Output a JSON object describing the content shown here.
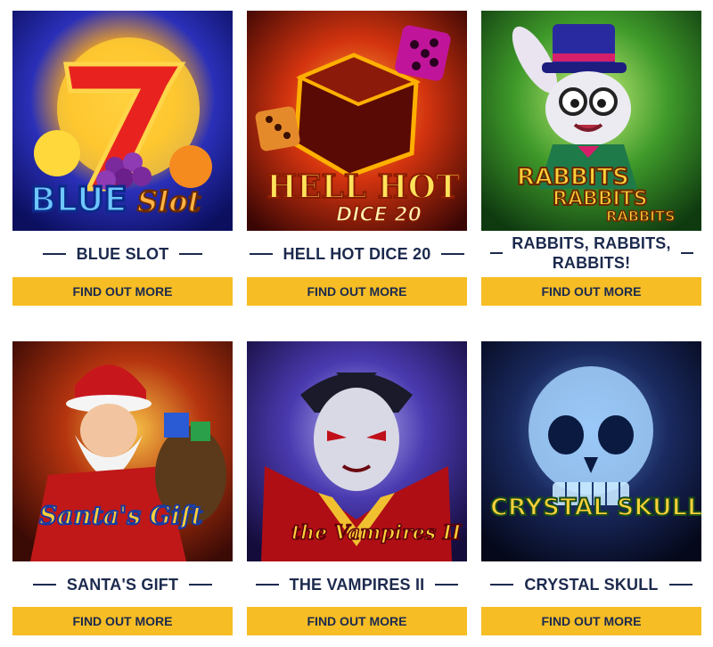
{
  "games": [
    {
      "title": "BLUE SLOT",
      "art_text": "BLUE",
      "art_text2": "Slot",
      "button": "FIND OUT MORE"
    },
    {
      "title": "HELL HOT DICE 20",
      "art_text": "HELL HOT",
      "art_text2": "DICE 20",
      "button": "FIND OUT MORE"
    },
    {
      "title": "RABBITS, RABBITS, RABBITS!",
      "art_text": "RABBITS",
      "art_text2": "RABBITS",
      "art_text3": "RABBITS",
      "button": "FIND OUT MORE"
    },
    {
      "title": "SANTA'S GIFT",
      "art_text": "Santa's Gift",
      "button": "FIND OUT MORE"
    },
    {
      "title": "THE VAMPIRES II",
      "art_text": "the Vampires II",
      "button": "FIND OUT MORE"
    },
    {
      "title": "CRYSTAL SKULL",
      "art_text": "CRYSTAL SKULL",
      "button": "FIND OUT MORE"
    }
  ],
  "colors": {
    "button": "#f6bd24",
    "title": "#1c2a4e"
  }
}
